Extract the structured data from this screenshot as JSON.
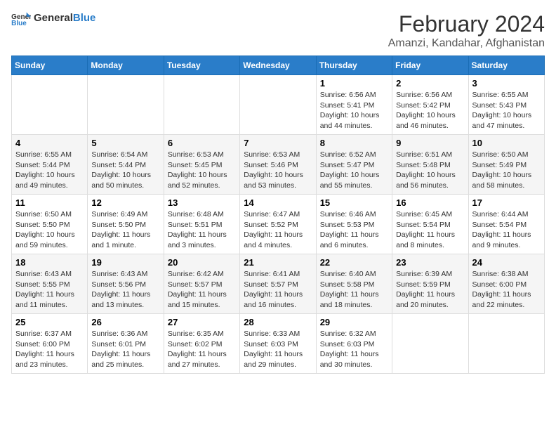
{
  "header": {
    "logo_general": "General",
    "logo_blue": "Blue",
    "title": "February 2024",
    "subtitle": "Amanzi, Kandahar, Afghanistan"
  },
  "weekdays": [
    "Sunday",
    "Monday",
    "Tuesday",
    "Wednesday",
    "Thursday",
    "Friday",
    "Saturday"
  ],
  "weeks": [
    [
      {
        "day": "",
        "info": ""
      },
      {
        "day": "",
        "info": ""
      },
      {
        "day": "",
        "info": ""
      },
      {
        "day": "",
        "info": ""
      },
      {
        "day": "1",
        "info": "Sunrise: 6:56 AM\nSunset: 5:41 PM\nDaylight: 10 hours\nand 44 minutes."
      },
      {
        "day": "2",
        "info": "Sunrise: 6:56 AM\nSunset: 5:42 PM\nDaylight: 10 hours\nand 46 minutes."
      },
      {
        "day": "3",
        "info": "Sunrise: 6:55 AM\nSunset: 5:43 PM\nDaylight: 10 hours\nand 47 minutes."
      }
    ],
    [
      {
        "day": "4",
        "info": "Sunrise: 6:55 AM\nSunset: 5:44 PM\nDaylight: 10 hours\nand 49 minutes."
      },
      {
        "day": "5",
        "info": "Sunrise: 6:54 AM\nSunset: 5:44 PM\nDaylight: 10 hours\nand 50 minutes."
      },
      {
        "day": "6",
        "info": "Sunrise: 6:53 AM\nSunset: 5:45 PM\nDaylight: 10 hours\nand 52 minutes."
      },
      {
        "day": "7",
        "info": "Sunrise: 6:53 AM\nSunset: 5:46 PM\nDaylight: 10 hours\nand 53 minutes."
      },
      {
        "day": "8",
        "info": "Sunrise: 6:52 AM\nSunset: 5:47 PM\nDaylight: 10 hours\nand 55 minutes."
      },
      {
        "day": "9",
        "info": "Sunrise: 6:51 AM\nSunset: 5:48 PM\nDaylight: 10 hours\nand 56 minutes."
      },
      {
        "day": "10",
        "info": "Sunrise: 6:50 AM\nSunset: 5:49 PM\nDaylight: 10 hours\nand 58 minutes."
      }
    ],
    [
      {
        "day": "11",
        "info": "Sunrise: 6:50 AM\nSunset: 5:50 PM\nDaylight: 10 hours\nand 59 minutes."
      },
      {
        "day": "12",
        "info": "Sunrise: 6:49 AM\nSunset: 5:50 PM\nDaylight: 11 hours\nand 1 minute."
      },
      {
        "day": "13",
        "info": "Sunrise: 6:48 AM\nSunset: 5:51 PM\nDaylight: 11 hours\nand 3 minutes."
      },
      {
        "day": "14",
        "info": "Sunrise: 6:47 AM\nSunset: 5:52 PM\nDaylight: 11 hours\nand 4 minutes."
      },
      {
        "day": "15",
        "info": "Sunrise: 6:46 AM\nSunset: 5:53 PM\nDaylight: 11 hours\nand 6 minutes."
      },
      {
        "day": "16",
        "info": "Sunrise: 6:45 AM\nSunset: 5:54 PM\nDaylight: 11 hours\nand 8 minutes."
      },
      {
        "day": "17",
        "info": "Sunrise: 6:44 AM\nSunset: 5:54 PM\nDaylight: 11 hours\nand 9 minutes."
      }
    ],
    [
      {
        "day": "18",
        "info": "Sunrise: 6:43 AM\nSunset: 5:55 PM\nDaylight: 11 hours\nand 11 minutes."
      },
      {
        "day": "19",
        "info": "Sunrise: 6:43 AM\nSunset: 5:56 PM\nDaylight: 11 hours\nand 13 minutes."
      },
      {
        "day": "20",
        "info": "Sunrise: 6:42 AM\nSunset: 5:57 PM\nDaylight: 11 hours\nand 15 minutes."
      },
      {
        "day": "21",
        "info": "Sunrise: 6:41 AM\nSunset: 5:57 PM\nDaylight: 11 hours\nand 16 minutes."
      },
      {
        "day": "22",
        "info": "Sunrise: 6:40 AM\nSunset: 5:58 PM\nDaylight: 11 hours\nand 18 minutes."
      },
      {
        "day": "23",
        "info": "Sunrise: 6:39 AM\nSunset: 5:59 PM\nDaylight: 11 hours\nand 20 minutes."
      },
      {
        "day": "24",
        "info": "Sunrise: 6:38 AM\nSunset: 6:00 PM\nDaylight: 11 hours\nand 22 minutes."
      }
    ],
    [
      {
        "day": "25",
        "info": "Sunrise: 6:37 AM\nSunset: 6:00 PM\nDaylight: 11 hours\nand 23 minutes."
      },
      {
        "day": "26",
        "info": "Sunrise: 6:36 AM\nSunset: 6:01 PM\nDaylight: 11 hours\nand 25 minutes."
      },
      {
        "day": "27",
        "info": "Sunrise: 6:35 AM\nSunset: 6:02 PM\nDaylight: 11 hours\nand 27 minutes."
      },
      {
        "day": "28",
        "info": "Sunrise: 6:33 AM\nSunset: 6:03 PM\nDaylight: 11 hours\nand 29 minutes."
      },
      {
        "day": "29",
        "info": "Sunrise: 6:32 AM\nSunset: 6:03 PM\nDaylight: 11 hours\nand 30 minutes."
      },
      {
        "day": "",
        "info": ""
      },
      {
        "day": "",
        "info": ""
      }
    ]
  ]
}
